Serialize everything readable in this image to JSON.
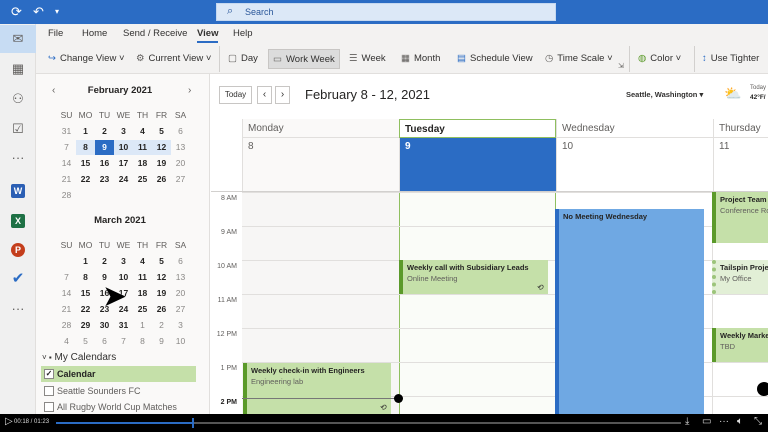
{
  "titlebar": {
    "search_placeholder": "Search"
  },
  "ribbon": {
    "tabs": [
      "File",
      "Home",
      "Send / Receive",
      "View",
      "Help"
    ],
    "commands": {
      "change_view": "Change View",
      "current_view": "Current View",
      "day": "Day",
      "work_week": "Work Week",
      "week": "Week",
      "month": "Month",
      "schedule_view": "Schedule View",
      "time_scale": "Time Scale",
      "color": "Color",
      "use_tighter": "Use Tighter"
    }
  },
  "mini_calendars": [
    {
      "title": "February 2021",
      "days": [
        "SU",
        "MO",
        "TU",
        "WE",
        "TH",
        "FR",
        "SA"
      ],
      "weeks": [
        [
          "31",
          "1",
          "2",
          "3",
          "4",
          "5",
          "6"
        ],
        [
          "7",
          "8",
          "9",
          "10",
          "11",
          "12",
          "13"
        ],
        [
          "14",
          "15",
          "16",
          "17",
          "18",
          "19",
          "20"
        ],
        [
          "21",
          "22",
          "23",
          "24",
          "25",
          "26",
          "27"
        ],
        [
          "28"
        ]
      ],
      "selected_week": 1,
      "today": "9"
    },
    {
      "title": "March 2021",
      "days": [
        "SU",
        "MO",
        "TU",
        "WE",
        "TH",
        "FR",
        "SA"
      ],
      "weeks": [
        [
          "",
          "1",
          "2",
          "3",
          "4",
          "5",
          "6"
        ],
        [
          "7",
          "8",
          "9",
          "10",
          "11",
          "12",
          "13"
        ],
        [
          "14",
          "15",
          "16",
          "17",
          "18",
          "19",
          "20"
        ],
        [
          "21",
          "22",
          "23",
          "24",
          "25",
          "26",
          "27"
        ],
        [
          "28",
          "29",
          "30",
          "31",
          "1",
          "2",
          "3"
        ],
        [
          "4",
          "5",
          "6",
          "7",
          "8",
          "9",
          "10"
        ]
      ]
    }
  ],
  "calendars": {
    "group": "My Calendars",
    "items": [
      {
        "label": "Calendar",
        "checked": true
      },
      {
        "label": "Seattle Sounders FC",
        "checked": false
      },
      {
        "label": "All Rugby World Cup Matches",
        "checked": false
      }
    ]
  },
  "main": {
    "today_label": "Today",
    "range_title": "February 8 - 12, 2021",
    "location": "Seattle, Washington",
    "weather_label": "Today",
    "weather_temp": "42°F/",
    "columns": [
      {
        "day": "Monday",
        "date": "8"
      },
      {
        "day": "Tuesday",
        "date": "9"
      },
      {
        "day": "Wednesday",
        "date": "10"
      },
      {
        "day": "Thursday",
        "date": "11"
      }
    ],
    "hours": [
      "8 AM",
      "9 AM",
      "10 AM",
      "11 AM",
      "12 PM",
      "1 PM",
      "2 PM"
    ],
    "events": {
      "monday": {
        "title": "Weekly check-in with Engineers",
        "location": "Engineering lab"
      },
      "tuesday": {
        "title": "Weekly call with Subsidiary Leads",
        "location": "Online Meeting"
      },
      "wednesday": {
        "title": "No Meeting Wednesday"
      },
      "thursday1": {
        "title": "Project Team M",
        "location": "Conference Roo"
      },
      "thursday2": {
        "title": "Tailspin Projec",
        "location": "My Office"
      },
      "thursday3": {
        "title": "Weekly Marke",
        "location": "TBD"
      }
    }
  },
  "video": {
    "time": "00:18 / 01:23",
    "progress": 0.217
  },
  "colors": {
    "accent": "#2b6cc4",
    "event_green": "#c5e0a9",
    "event_blue": "#6fa8e3"
  }
}
